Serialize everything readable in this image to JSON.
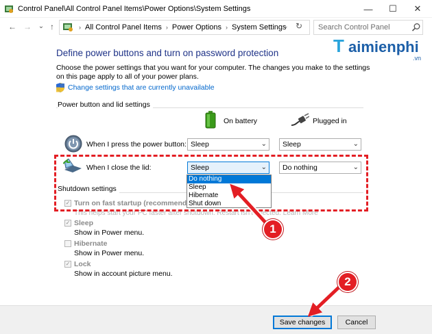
{
  "window": {
    "title": "Control Panel\\All Control Panel Items\\Power Options\\System Settings",
    "minimize_glyph": "—",
    "maximize_glyph": "☐",
    "close_glyph": "✕"
  },
  "nav": {
    "back_glyph": "←",
    "forward_glyph": "→",
    "recent_glyph": "⌄",
    "up_glyph": "↑",
    "breadcrumbs": [
      "All Control Panel Items",
      "Power Options",
      "System Settings"
    ],
    "breadcrumb_sep": "›",
    "addr_dropdown_glyph": "⌄",
    "refresh_glyph": "↻",
    "search_placeholder": "Search Control Panel"
  },
  "logo": {
    "letter": "T",
    "rest": "aimienphi",
    "suffix": ".vn"
  },
  "content": {
    "heading": "Define power buttons and turn on password protection",
    "description": "Choose the power settings that you want for your computer. The changes you make to the settings on this page apply to all of your power plans.",
    "change_link": "Change settings that are currently unavailable",
    "group_power": "Power button and lid settings",
    "col_battery": "On battery",
    "col_plugged": "Plugged in",
    "row_power_button": "When I press the power button:",
    "row_lid": "When I close the lid:",
    "power_battery_value": "Sleep",
    "power_plugged_value": "Sleep",
    "lid_battery_value": "Sleep",
    "lid_plugged_value": "Do nothing",
    "lid_options": [
      "Do nothing",
      "Sleep",
      "Hibernate",
      "Shut down"
    ],
    "lid_highlighted_option": "Do nothing",
    "group_shutdown": "Shutdown settings",
    "fast_startup_label": "Turn on fast startup (recommended)",
    "fast_startup_desc": "This helps start your PC faster after shutdown. Restart isn't affected. Learn More",
    "sleep_label": "Sleep",
    "sleep_desc": "Show in Power menu.",
    "hibernate_label": "Hibernate",
    "hibernate_desc": "Show in Power menu.",
    "lock_label": "Lock",
    "lock_desc": "Show in account picture menu."
  },
  "buttons": {
    "save": "Save changes",
    "cancel": "Cancel"
  },
  "annotations": {
    "step1": "1",
    "step2": "2",
    "highlight_color": "#e31e24"
  }
}
